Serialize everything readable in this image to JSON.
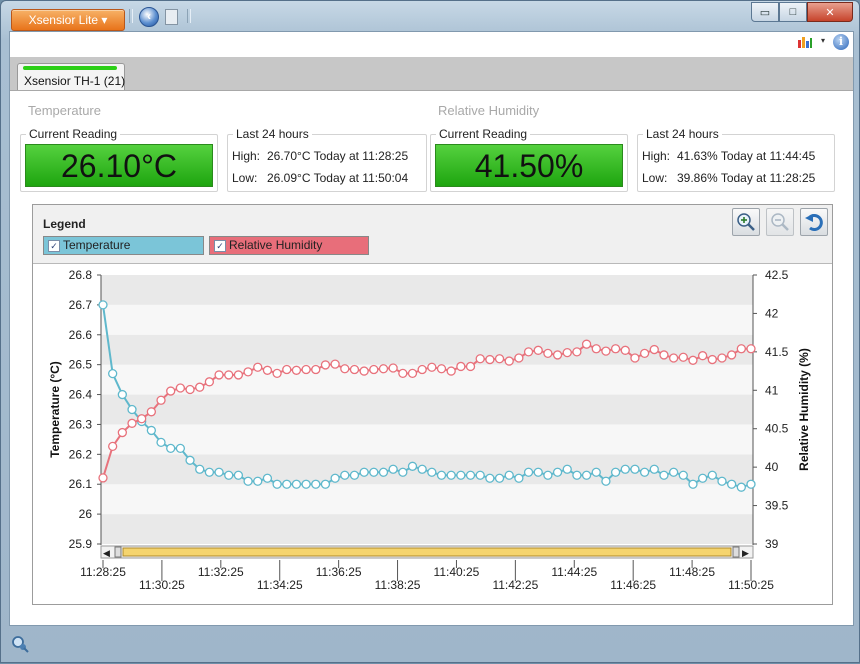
{
  "window": {
    "app_menu_label": "Xsensior Lite ▾",
    "min_glyph": "▭",
    "max_glyph": "□",
    "close_glyph": "✕"
  },
  "toolbar": {
    "info_glyph": "i",
    "dropdown_glyph": "▾"
  },
  "tab": {
    "label": "Xsensior TH-1 (21)"
  },
  "temperature": {
    "section_title": "Temperature",
    "current_label": "Current Reading",
    "current_value": "26.10°C",
    "last24_label": "Last 24 hours",
    "high_label": "High:",
    "high_value": "26.70°C Today at 11:28:25",
    "low_label": "Low:",
    "low_value": "26.09°C Today at 11:50:04"
  },
  "humidity": {
    "section_title": "Relative Humidity",
    "current_label": "Current Reading",
    "current_value": "41.50%",
    "last24_label": "Last 24 hours",
    "high_label": "High:",
    "high_value": "41.63% Today at 11:44:45",
    "low_label": "Low:",
    "low_value": "39.86% Today at 11:28:25"
  },
  "legend": {
    "title": "Legend",
    "items": [
      {
        "label": "Temperature",
        "checked": true,
        "color": "#7bc5d8"
      },
      {
        "label": "Relative Humidity",
        "checked": true,
        "color": "#e86e7a"
      }
    ]
  },
  "colors": {
    "temperature": "#5fb8cc",
    "humidity": "#e8727c",
    "accent_green": "#2ccf17",
    "scroll_thumb": "#f5d46e"
  },
  "chart_data": {
    "type": "line",
    "x_ticks": [
      "11:28:25",
      "11:30:25",
      "11:32:25",
      "11:34:25",
      "11:36:25",
      "11:38:25",
      "11:40:25",
      "11:42:25",
      "11:44:25",
      "11:46:25",
      "11:48:25",
      "11:50:25"
    ],
    "y_left": {
      "label": "Temperature (°C)",
      "ylim": [
        25.9,
        26.8
      ],
      "ticks": [
        "25.9",
        "26",
        "26.1",
        "26.2",
        "26.3",
        "26.4",
        "26.5",
        "26.6",
        "26.7",
        "26.8"
      ]
    },
    "y_right": {
      "label": "Relative Humidity (%)",
      "ylim": [
        39,
        42.5
      ],
      "ticks": [
        "39",
        "39.5",
        "40",
        "40.5",
        "41",
        "41.5",
        "42",
        "42.5"
      ]
    },
    "grid": "alternating horizontal bands",
    "series": [
      {
        "name": "Temperature",
        "axis": "left",
        "values": [
          26.7,
          26.47,
          26.4,
          26.35,
          26.31,
          26.28,
          26.24,
          26.22,
          26.22,
          26.18,
          26.15,
          26.14,
          26.14,
          26.13,
          26.13,
          26.11,
          26.11,
          26.12,
          26.1,
          26.1,
          26.1,
          26.1,
          26.1,
          26.1,
          26.12,
          26.13,
          26.13,
          26.14,
          26.14,
          26.14,
          26.15,
          26.14,
          26.16,
          26.15,
          26.14,
          26.13,
          26.13,
          26.13,
          26.13,
          26.13,
          26.12,
          26.12,
          26.13,
          26.12,
          26.14,
          26.14,
          26.13,
          26.14,
          26.15,
          26.13,
          26.13,
          26.14,
          26.11,
          26.14,
          26.15,
          26.15,
          26.14,
          26.15,
          26.13,
          26.14,
          26.13,
          26.1,
          26.12,
          26.13,
          26.11,
          26.1,
          26.09,
          26.1
        ]
      },
      {
        "name": "Relative Humidity",
        "axis": "right",
        "values": [
          39.86,
          40.27,
          40.45,
          40.57,
          40.63,
          40.72,
          40.87,
          40.99,
          41.03,
          41.01,
          41.04,
          41.11,
          41.2,
          41.2,
          41.2,
          41.24,
          41.3,
          41.26,
          41.22,
          41.27,
          41.26,
          41.27,
          41.27,
          41.33,
          41.34,
          41.28,
          41.27,
          41.25,
          41.27,
          41.28,
          41.29,
          41.22,
          41.22,
          41.27,
          41.3,
          41.28,
          41.25,
          41.31,
          41.31,
          41.41,
          41.4,
          41.41,
          41.38,
          41.42,
          41.5,
          41.52,
          41.48,
          41.46,
          41.49,
          41.5,
          41.6,
          41.54,
          41.51,
          41.54,
          41.52,
          41.42,
          41.48,
          41.53,
          41.46,
          41.42,
          41.43,
          41.39,
          41.45,
          41.4,
          41.42,
          41.46,
          41.54,
          41.54
        ]
      }
    ]
  }
}
